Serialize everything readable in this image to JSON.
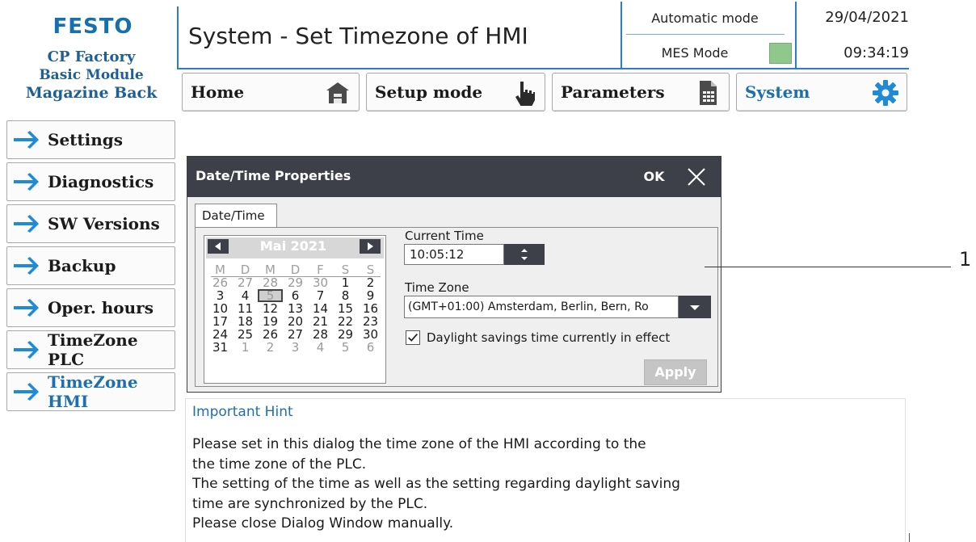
{
  "header": {
    "logo": "FESTO",
    "station_line1": "CP Factory",
    "station_line2": "Basic Module",
    "station_line3": "Magazine Back",
    "title": "System - Set Timezone of HMI",
    "status_mode": "Automatic mode",
    "mes_mode": "MES Mode",
    "mes_led_color": "#8fc88a",
    "date": "29/04/2021",
    "time": "09:34:19"
  },
  "nav": [
    {
      "label": "Home",
      "icon": "house-icon"
    },
    {
      "label": "Setup mode",
      "icon": "hand-pointer-icon"
    },
    {
      "label": "Parameters",
      "icon": "document-grid-icon"
    },
    {
      "label": "System",
      "icon": "gear-icon"
    }
  ],
  "sidebar": {
    "items": [
      {
        "label": "Settings"
      },
      {
        "label": "Diagnostics"
      },
      {
        "label": "SW Versions"
      },
      {
        "label": "Backup"
      },
      {
        "label": "Oper. hours"
      },
      {
        "label": "TimeZone PLC"
      },
      {
        "label": "TimeZone HMI"
      }
    ]
  },
  "dialog": {
    "title": "Date/Time Properties",
    "ok_label": "OK",
    "tab_label": "Date/Time",
    "calendar": {
      "month": "Mai 2021",
      "weekdays": [
        "M",
        "D",
        "M",
        "D",
        "F",
        "S",
        "S"
      ],
      "weeks": [
        [
          "26",
          "27",
          "28",
          "29",
          "30",
          "1",
          "2"
        ],
        [
          "3",
          "4",
          "5",
          "6",
          "7",
          "8",
          "9"
        ],
        [
          "10",
          "11",
          "12",
          "13",
          "14",
          "15",
          "16"
        ],
        [
          "17",
          "18",
          "19",
          "20",
          "21",
          "22",
          "23"
        ],
        [
          "24",
          "25",
          "26",
          "27",
          "28",
          "29",
          "30"
        ],
        [
          "31",
          "1",
          "2",
          "3",
          "4",
          "5",
          "6"
        ]
      ],
      "selected_day": "5"
    },
    "current_time_label": "Current Time",
    "current_time_value": "10:05:12",
    "time_zone_label": "Time Zone",
    "time_zone_value": "(GMT+01:00) Amsterdam, Berlin, Bern, Ro",
    "dst_label": "Daylight savings time currently in effect",
    "dst_checked": true,
    "apply_label": "Apply"
  },
  "callout": "1",
  "hint": {
    "title": "Important Hint",
    "lines": [
      "Please set in this dialog the time zone of the HMI according to the",
      "the time zone of the PLC.",
      "The setting of the time as well as the setting regarding daylight saving",
      "time are synchronized by the PLC.",
      "Please close Dialog Window manually."
    ]
  }
}
